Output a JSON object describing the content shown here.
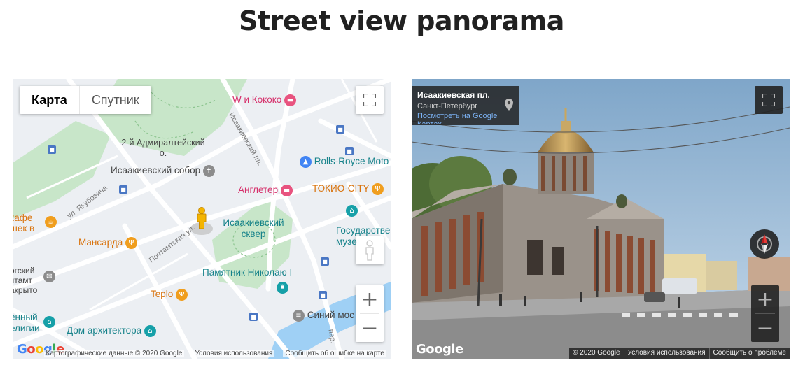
{
  "page": {
    "title": "Street view panorama"
  },
  "map": {
    "type_buttons": [
      "Карта",
      "Спутник"
    ],
    "zoom_in": "+",
    "zoom_out": "−",
    "pois": {
      "w_kokoko": "W и Кококо",
      "admiralteysky": "2-й Адмиралтейский о.",
      "isaakievsky_sobor": "Исаакиевский собор",
      "rolls_royce": "Rolls-Royce Moto",
      "angleter": "Англетер",
      "tokio_city": "ТОКИО-CITY",
      "isaakievsky_skver": "Исаакиевский сквер",
      "gosudarstv": "Государстве музе",
      "kafe": "кафе шек в",
      "mansarda": "Мансарда",
      "pamyatnik": "Памятник Николаю I",
      "teplo": "Teplo",
      "ogsky": "огский чтамт акрыто",
      "religii": "енный елигии",
      "dom_arkhitektora": "Дом архитектора",
      "siniy_most": "Синий мос"
    },
    "streets": {
      "isaakievsky_pl": "Исаакиевский пл.",
      "yakubovicha": "ул. Якубовича",
      "pochtamtskaya": "Почтамтская ул.",
      "per": "пер."
    },
    "footer": {
      "data": "Картографические данные © 2020 Google",
      "terms": "Условия использования",
      "report": "Сообщить об ошибке на карте"
    },
    "google_logo": "Google"
  },
  "streetview": {
    "address": {
      "title": "Исаакиевская пл.",
      "city": "Санкт-Петербург",
      "link": "Посмотреть на Google",
      "link2": "Картах"
    },
    "zoom_in": "+",
    "zoom_out": "−",
    "google_logo": "Google",
    "footer": {
      "copyright": "© 2020 Google",
      "terms": "Условия использования",
      "report": "Сообщить о проблеме"
    }
  },
  "colors": {
    "park_green": "#c8e6c9",
    "water_blue": "#9fd0f5",
    "teal": "#16828a",
    "orange": "#d9720b",
    "pink": "#d6306b"
  }
}
